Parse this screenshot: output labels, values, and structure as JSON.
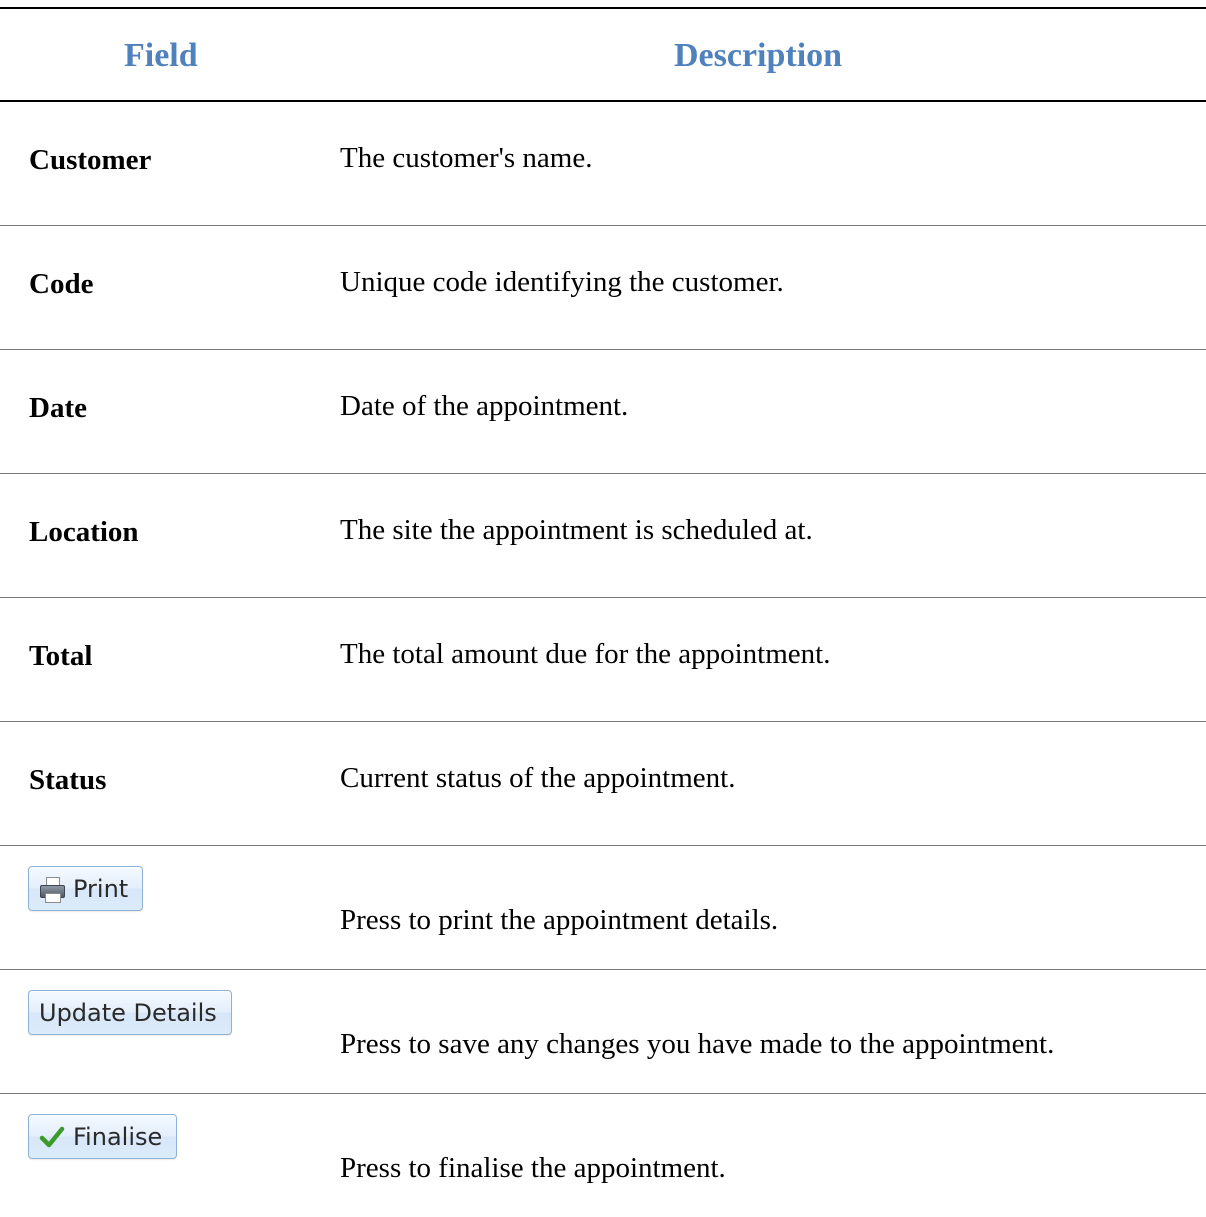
{
  "table": {
    "headers": {
      "field": "Field",
      "description": "Description"
    },
    "rows": [
      {
        "field": "Customer",
        "description": "The customer's name."
      },
      {
        "field": "Code",
        "description": "Unique code identifying the customer."
      },
      {
        "field": "Date",
        "description": "Date of the appointment."
      },
      {
        "field": "Location",
        "description": "The site the appointment is scheduled at."
      },
      {
        "field": "Total",
        "description": "The total amount due for the appointment."
      },
      {
        "field": "Status",
        "description": "Current status of the appointment."
      }
    ],
    "button_rows": [
      {
        "button_label": "Print",
        "icon": "printer-icon",
        "description": "Press to print the appointment details."
      },
      {
        "button_label": "Update Details",
        "icon": "",
        "description": "Press to save any changes you have made to the appointment."
      },
      {
        "button_label": "Finalise",
        "icon": "check-icon",
        "description": "Press to finalise the appointment."
      }
    ]
  },
  "colors": {
    "header_text": "#4f81bd",
    "button_border": "#8db2d6",
    "check_green": "#3a9a2a"
  }
}
